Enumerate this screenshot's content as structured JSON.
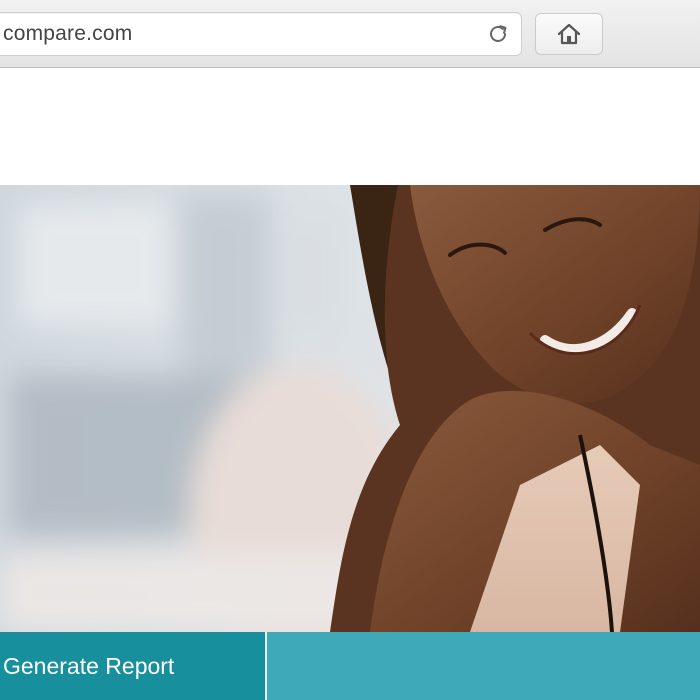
{
  "browser": {
    "url": "compare.com",
    "icons": {
      "reload": "reload-icon",
      "home": "home-icon"
    }
  },
  "hero": {
    "image": "hero-photo-smiling-woman"
  },
  "actions": {
    "generate_report_label": "Generate Report"
  },
  "colors": {
    "primary_teal": "#188f9d",
    "secondary_teal": "#3ea9b8",
    "chrome_gray": "#e8e8e8"
  }
}
